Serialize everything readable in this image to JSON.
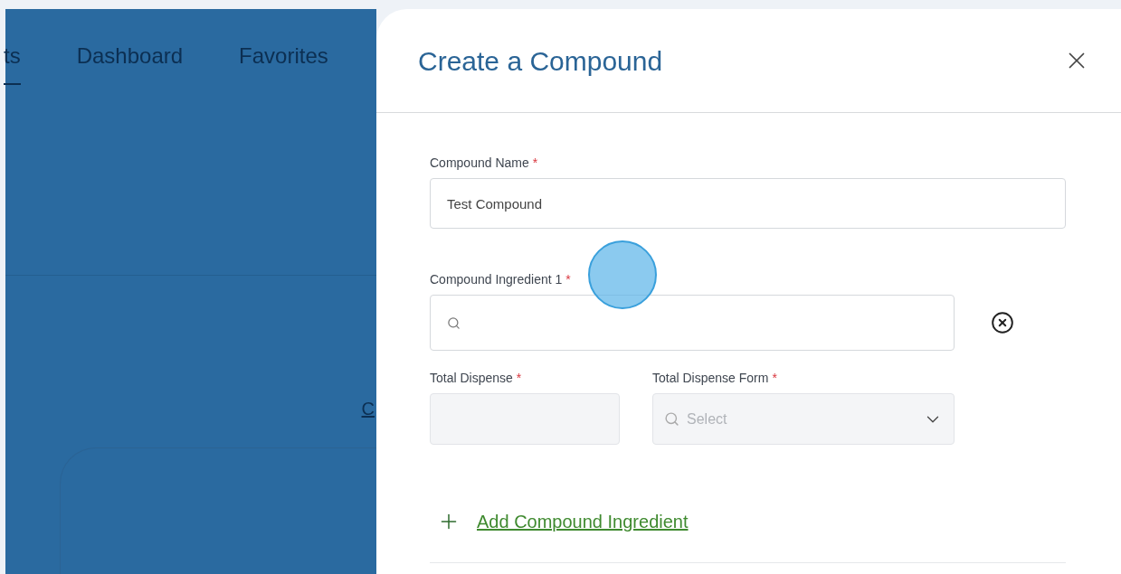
{
  "background_page": {
    "tabs": [
      {
        "label": "ts",
        "selected": true
      },
      {
        "label": "Dashboard",
        "selected": false
      },
      {
        "label": "Favorites",
        "selected": false
      }
    ],
    "link": "C"
  },
  "drawer": {
    "title": "Create a Compound",
    "compound_name": {
      "label": "Compound Name",
      "required_mark": "*",
      "value": "Test Compound",
      "disabled": false
    },
    "ingredient": {
      "label": "Compound Ingredient 1",
      "required_mark": "*",
      "disabled": false
    },
    "total_dispense": {
      "label": "Total Dispense",
      "required_mark": "*",
      "disabled": true
    },
    "total_dispense_form": {
      "label": "Total Dispense Form",
      "required_mark": "*",
      "placeholder": "Select",
      "disabled": true
    },
    "add_link": "Add Compound Ingredient"
  }
}
